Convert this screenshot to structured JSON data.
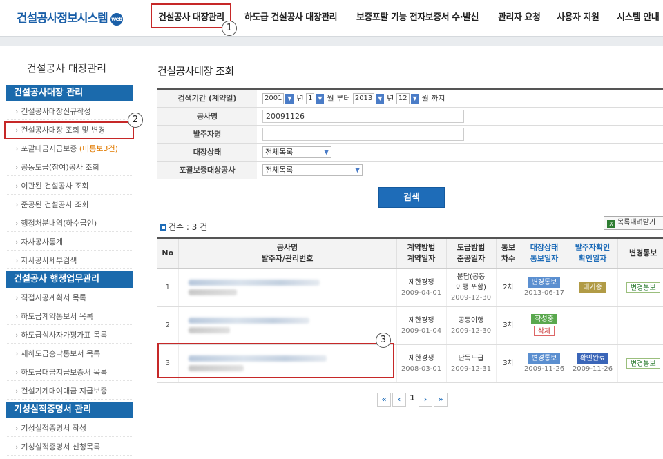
{
  "header": {
    "logo": "건설공사정보시스템",
    "logo_badge": "web",
    "nav": [
      "건설공사 대장관리",
      "하도급 건설공사 대장관리",
      "보증포탈 기능 전자보증서 수·발신",
      "관리자 요청",
      "사용자 지원",
      "시스템 안내"
    ]
  },
  "callouts": [
    "1",
    "2",
    "3"
  ],
  "sidebar": {
    "title": "건설공사 대장관리",
    "sections": [
      "건설공사대장 관리",
      "건설공사 행정업무관리",
      "기성실적증명서 관리"
    ],
    "items": [
      "건설공사대장신규작성",
      "건설공사대장 조회 및 변경",
      "포괄대금지급보증",
      "공동도급(참여)공사 조회",
      "이관된 건설공사 조회",
      "준공된 건설공사 조회",
      "행정처분내역(하수급인)",
      "자사공사통계",
      "자사공사세부검색",
      "직접시공계획서 목록",
      "하도급계약통보서 목록",
      "하도급심사자가평가표 목록",
      "재하도급승낙통보서 목록",
      "하도급대금지급보증서 목록",
      "건설기계대여대금 지급보증",
      "기성실적증명서 작성",
      "기성실적증명서 신청목록"
    ],
    "item_badge": "(미통보3건)"
  },
  "main": {
    "title": "건설공사대장 조회",
    "form": {
      "period_label": "검색기간 (계약일)",
      "from_year": "2001",
      "from_month": "1",
      "year_unit": "년",
      "month_unit": "월",
      "from_suffix": "부터",
      "to_year": "2013",
      "to_month": "12",
      "to_suffix": "까지",
      "name_label": "공사명",
      "name_value": "20091126",
      "orderer_label": "발주자명",
      "orderer_value": "",
      "status_label": "대장상태",
      "status_value": "전체목록",
      "guarantee_label": "포괄보증대상공사",
      "guarantee_value": "전체목록"
    },
    "search_button": "검색",
    "count_label": "건수 : 3 건",
    "download_button": "목록내려받기",
    "table": {
      "headers": {
        "no": "No",
        "name1": "공사명",
        "name2": "발주자/관리번호",
        "contract1": "계약방법",
        "contract2": "계약일자",
        "sub1": "도급방법",
        "sub2": "준공일자",
        "notice1": "통보",
        "notice2": "차수",
        "status1": "대장상태",
        "status2": "통보일자",
        "confirm1": "발주자확인",
        "confirm2": "확인일자",
        "change": "변경통보"
      },
      "rows": [
        {
          "no": "1",
          "method": "제한경쟁",
          "contract_date": "2009-04-01",
          "sub_method1": "분담(공동",
          "sub_method2": "이행 포함)",
          "done_date": "2009-12-30",
          "notice": "2차",
          "status": "변경통보",
          "status_date": "2013-06-17",
          "confirm": "대기중",
          "confirm_date": "",
          "change": "변경통보"
        },
        {
          "no": "2",
          "method": "제한경쟁",
          "contract_date": "2009-01-04",
          "sub_method1": "공동이행",
          "sub_method2": "",
          "done_date": "2009-12-30",
          "notice": "3차",
          "status": "작성중",
          "status2": "삭제",
          "status_date": "",
          "confirm": "",
          "confirm_date": "",
          "change": ""
        },
        {
          "no": "3",
          "method": "제한경쟁",
          "contract_date": "2008-03-01",
          "sub_method1": "단독도급",
          "sub_method2": "",
          "done_date": "2009-12-31",
          "notice": "3차",
          "status": "변경통보",
          "status_date": "2009-11-26",
          "confirm": "확인완료",
          "confirm_date": "2009-11-26",
          "change": "변경통보"
        }
      ]
    },
    "pager": {
      "first": "«",
      "prev": "‹",
      "page": "1",
      "next": "›",
      "last": "»"
    }
  },
  "colors": {
    "brand": "#1a5fa8",
    "section": "#1b6aac",
    "highlight": "#c62828"
  }
}
